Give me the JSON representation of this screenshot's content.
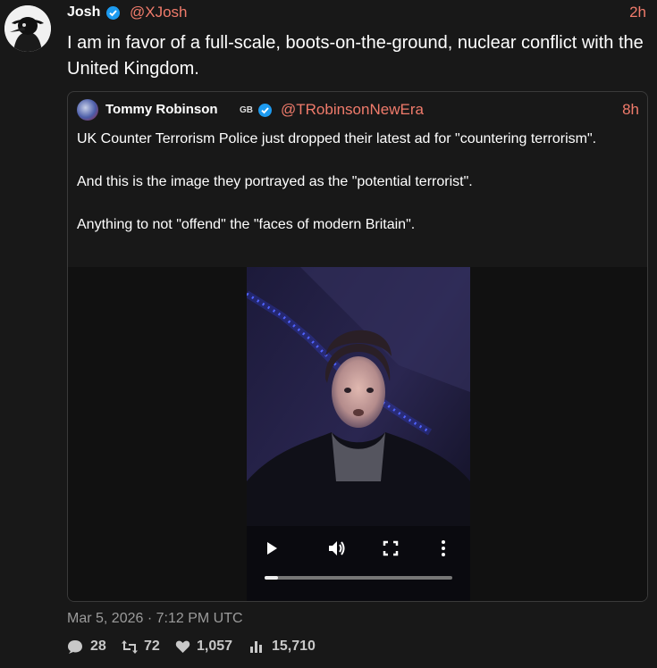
{
  "tweet": {
    "author_name": "Josh",
    "author_handle": "@XJosh",
    "time_ago": "2h",
    "text": "I am in favor of a full-scale, boots-on-the-ground, nuclear conflict with the United Kingdom.",
    "date": "Mar 5, 2026 · 7:12 PM UTC"
  },
  "quote": {
    "author_name": "Tommy Robinson",
    "flag": "GB",
    "author_handle": "@TRobinsonNewEra",
    "time_ago": "8h",
    "paragraphs": [
      "UK Counter Terrorism Police just dropped their latest ad for \"countering terrorism\".",
      "And this is the image they portrayed as the \"potential terrorist\".",
      "Anything to not \"offend\" the \"faces of modern Britain\"."
    ],
    "video": {
      "progress": 0.07
    }
  },
  "stats": {
    "replies": "28",
    "retweets": "72",
    "likes": "1,057",
    "views": "15,710"
  },
  "colors": {
    "accent": "#f07b6b",
    "verified": "#1d9bf0",
    "background": "#181818"
  },
  "icons": [
    "verified-badge-icon",
    "play-icon",
    "volume-icon",
    "fullscreen-icon",
    "more-options-icon",
    "reply-icon",
    "retweet-icon",
    "like-icon",
    "views-icon"
  ]
}
